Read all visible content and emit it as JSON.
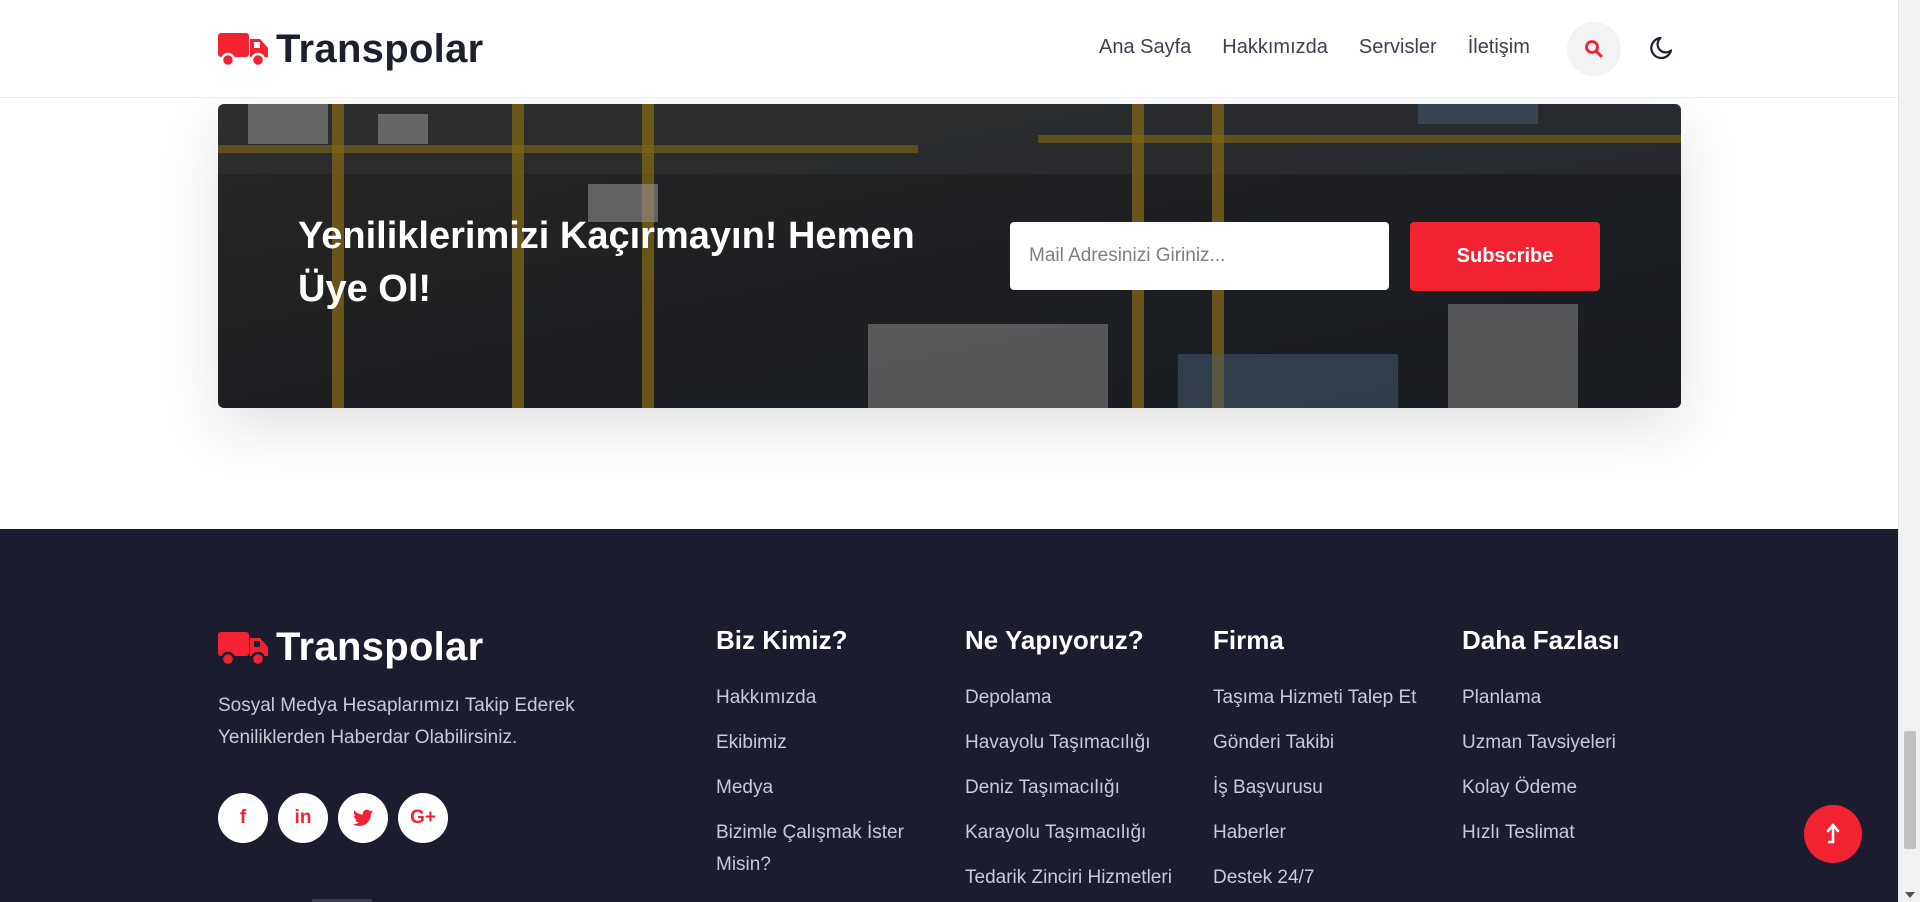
{
  "header": {
    "brand": "Transpolar",
    "nav": [
      "Ana Sayfa",
      "Hakkımızda",
      "Servisler",
      "İletişim"
    ]
  },
  "newsletter": {
    "title": "Yeniliklerimizi Kaçırmayın! Hemen Üye Ol!",
    "email_placeholder": "Mail Adresinizi Giriniz...",
    "subscribe_label": "Subscribe"
  },
  "footer": {
    "brand": "Transpolar",
    "description": "Sosyal Medya Hesaplarımızı Takip Ederek Yeniliklerden Haberdar Olabilirsiniz.",
    "socials": [
      {
        "icon": "facebook-icon",
        "glyph": "f"
      },
      {
        "icon": "linkedin-icon",
        "glyph": "in"
      },
      {
        "icon": "twitter-icon",
        "glyph": "🐦"
      },
      {
        "icon": "google-plus-icon",
        "glyph": "G+"
      }
    ],
    "columns": [
      {
        "title": "Biz Kimiz?",
        "items": [
          "Hakkımızda",
          "Ekibimiz",
          "Medya",
          "Bizimle Çalışmak İster Misin?"
        ]
      },
      {
        "title": "Ne Yapıyoruz?",
        "items": [
          "Depolama",
          "Havayolu Taşımacılığı",
          "Deniz Taşımacılığı",
          "Karayolu Taşımacılığı",
          "Tedarik Zinciri Hizmetleri"
        ]
      },
      {
        "title": "Firma",
        "items": [
          "Taşıma Hizmeti Talep Et",
          "Gönderi Takibi",
          "İş Başvurusu",
          "Haberler",
          "Destek 24/7"
        ]
      },
      {
        "title": "Daha Fazlası",
        "items": [
          "Planlama",
          "Uzman Tavsiyeleri",
          "Kolay Ödeme",
          "Hızlı Teslimat"
        ]
      }
    ]
  },
  "colors": {
    "accent": "#f32231",
    "footer_bg": "#1b1c2e",
    "text_dark": "#1c1f2e"
  }
}
